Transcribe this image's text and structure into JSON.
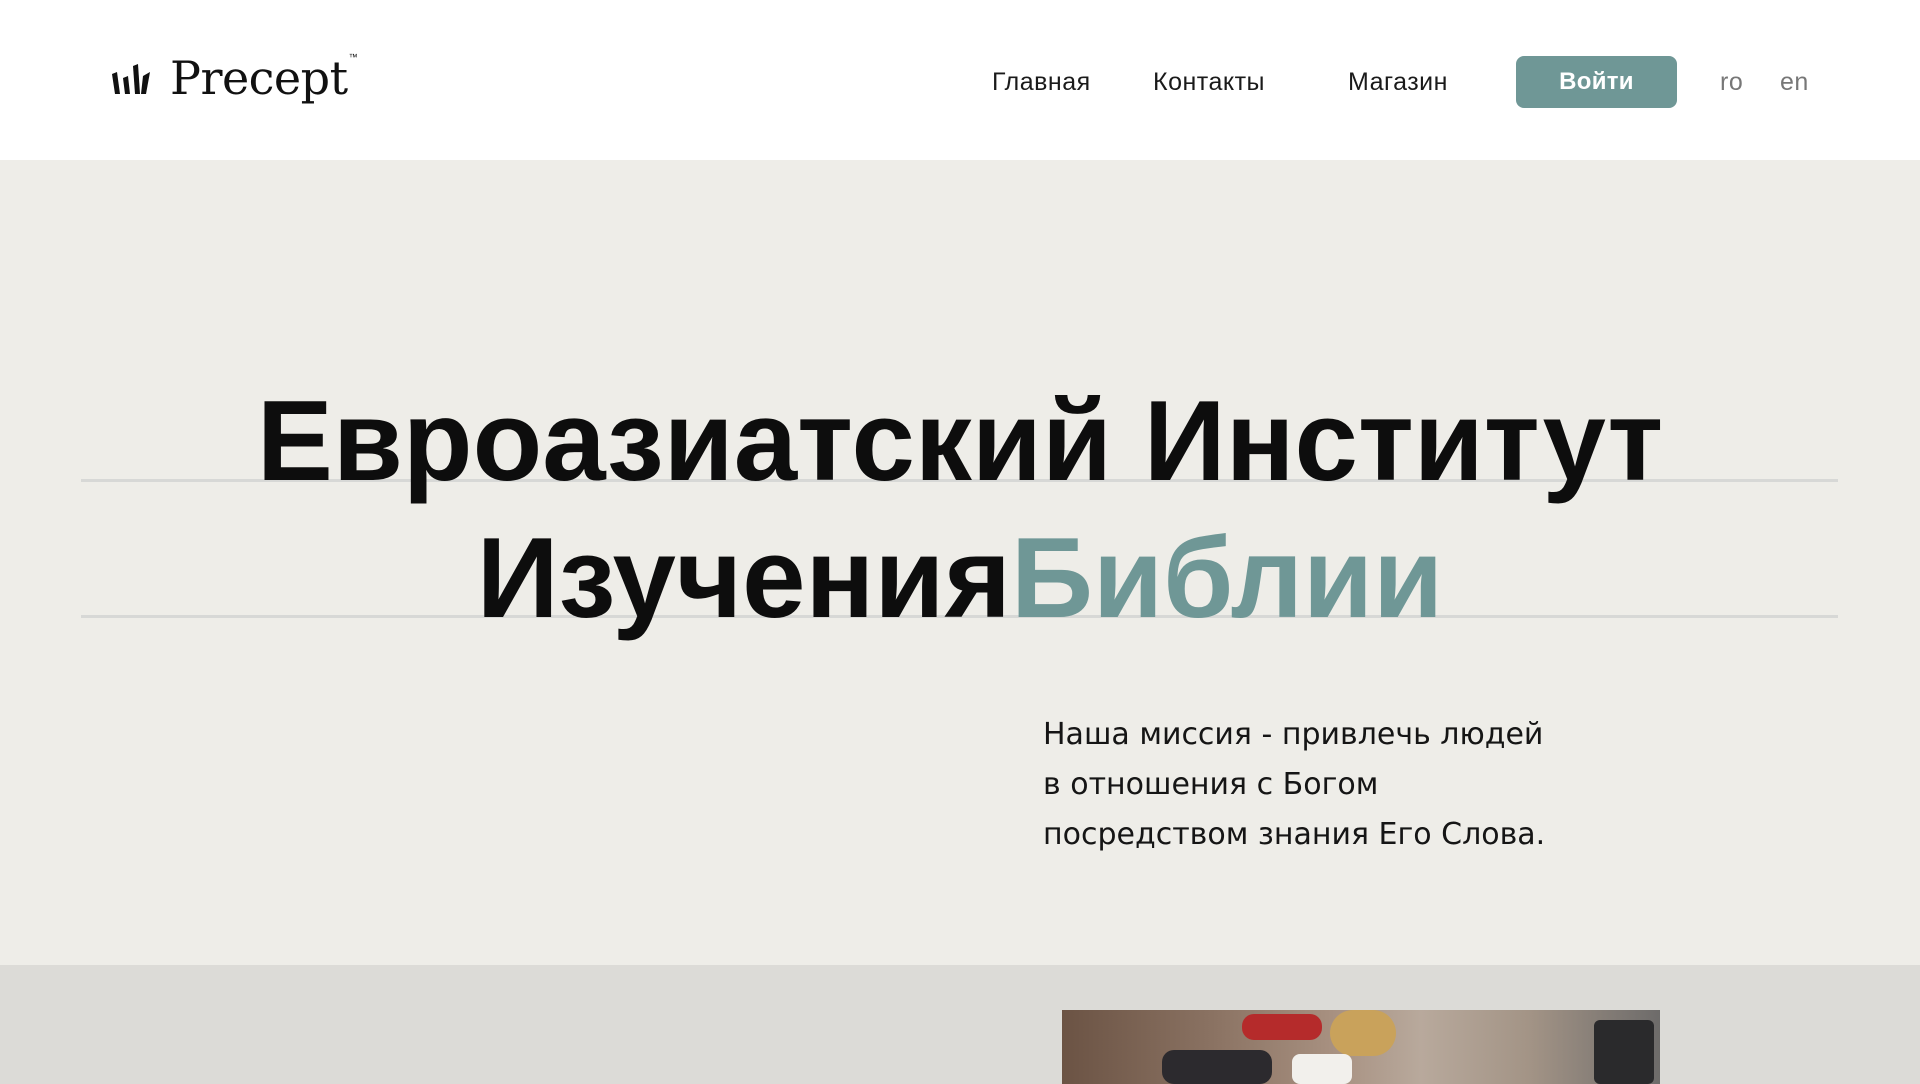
{
  "header": {
    "logo": {
      "text": "Precept",
      "trademark": "™",
      "icon": "bars-logo-icon"
    },
    "nav": [
      {
        "label": "Главная"
      },
      {
        "label": "Контакты"
      },
      {
        "label": "Магазин"
      }
    ],
    "login_label": "Войти",
    "languages": [
      "ro",
      "en"
    ]
  },
  "hero": {
    "title_line1": "Евроазиатский Институт",
    "title_line2_main": "Изучения",
    "title_line2_accent": "Библии",
    "mission_lines": [
      "Наша миссия - привлечь людей",
      "в отношения с Богом",
      "посредством знания Его Слова."
    ]
  },
  "colors": {
    "accent": "#6f9796",
    "hero_background": "#eeede8",
    "lower_background": "#dcdbd7",
    "text": "#111111"
  }
}
